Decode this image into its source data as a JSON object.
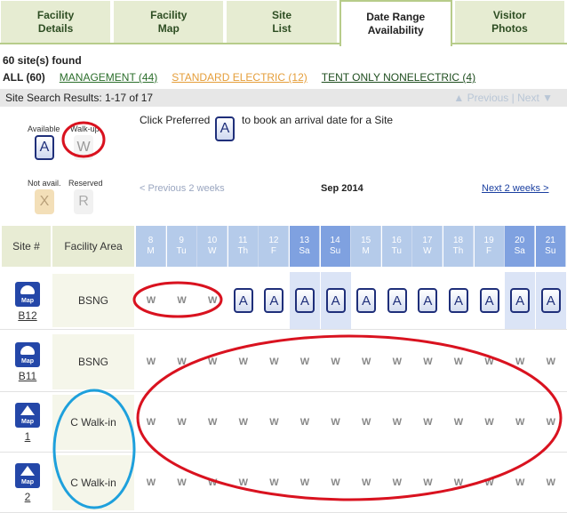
{
  "tabs": [
    {
      "label": "Facility\nDetails",
      "active": false
    },
    {
      "label": "Facility\nMap",
      "active": false
    },
    {
      "label": "Site\nList",
      "active": false
    },
    {
      "label": "Date Range\nAvailability",
      "active": true
    },
    {
      "label": "Visitor\nPhotos",
      "active": false
    }
  ],
  "found_text": "60 site(s) found",
  "filters": {
    "all": "ALL (60)",
    "management": "MANAGEMENT (44)",
    "standard_electric": "STANDARD ELECTRIC (12)",
    "tent_only": "TENT ONLY NONELECTRIC (4)"
  },
  "results_bar": {
    "label": "Site Search Results: 1-17 of 17",
    "previous": "▲ Previous",
    "separator": "|",
    "next": "Next ▼"
  },
  "legend": {
    "available_label": "Available",
    "available_tile": "A",
    "walkup_label": "Walk-up",
    "walkup_tile": "W",
    "notavail_label": "Not avail.",
    "notavail_tile": "X",
    "reserved_label": "Reserved",
    "reserved_tile": "R"
  },
  "instructions": {
    "before": "Click Preferred",
    "tile": "A",
    "after": "to book an arrival date for a Site"
  },
  "nav": {
    "prev": "< Previous 2 weeks",
    "month": "Sep 2014",
    "next": "Next 2 weeks >"
  },
  "grid": {
    "site_header": "Site #",
    "area_header": "Facility Area",
    "dates": [
      {
        "day": "8",
        "dow": "M",
        "weekend": false
      },
      {
        "day": "9",
        "dow": "Tu",
        "weekend": false
      },
      {
        "day": "10",
        "dow": "W",
        "weekend": false
      },
      {
        "day": "11",
        "dow": "Th",
        "weekend": false
      },
      {
        "day": "12",
        "dow": "F",
        "weekend": false
      },
      {
        "day": "13",
        "dow": "Sa",
        "weekend": true
      },
      {
        "day": "14",
        "dow": "Su",
        "weekend": true
      },
      {
        "day": "15",
        "dow": "M",
        "weekend": false
      },
      {
        "day": "16",
        "dow": "Tu",
        "weekend": false
      },
      {
        "day": "17",
        "dow": "W",
        "weekend": false
      },
      {
        "day": "18",
        "dow": "Th",
        "weekend": false
      },
      {
        "day": "19",
        "dow": "F",
        "weekend": false
      },
      {
        "day": "20",
        "dow": "Sa",
        "weekend": true
      },
      {
        "day": "21",
        "dow": "Su",
        "weekend": true
      }
    ],
    "rows": [
      {
        "site": "B12",
        "icon": "map-car-icon",
        "area": "BSNG",
        "shaded": true,
        "cells": [
          "W",
          "W",
          "W",
          "A",
          "A",
          "A",
          "A",
          "A",
          "A",
          "A",
          "A",
          "A",
          "A",
          "A"
        ]
      },
      {
        "site": "B11",
        "icon": "map-car-icon",
        "area": "BSNG",
        "shaded": false,
        "cells": [
          "W",
          "W",
          "W",
          "W",
          "W",
          "W",
          "W",
          "W",
          "W",
          "W",
          "W",
          "W",
          "W",
          "W"
        ]
      },
      {
        "site": "1",
        "icon": "map-tent-icon",
        "area": "C Walk-in",
        "shaded": false,
        "cells": [
          "W",
          "W",
          "W",
          "W",
          "W",
          "W",
          "W",
          "W",
          "W",
          "W",
          "W",
          "W",
          "W",
          "W"
        ]
      },
      {
        "site": "2",
        "icon": "map-tent-icon",
        "area": "C Walk-in",
        "shaded": false,
        "cells": [
          "W",
          "W",
          "W",
          "W",
          "W",
          "W",
          "W",
          "W",
          "W",
          "W",
          "W",
          "W",
          "W",
          "W"
        ]
      }
    ],
    "map_label": "Map"
  },
  "annotation_colors": {
    "red": "#d9121f",
    "blue": "#1ea0dc"
  }
}
